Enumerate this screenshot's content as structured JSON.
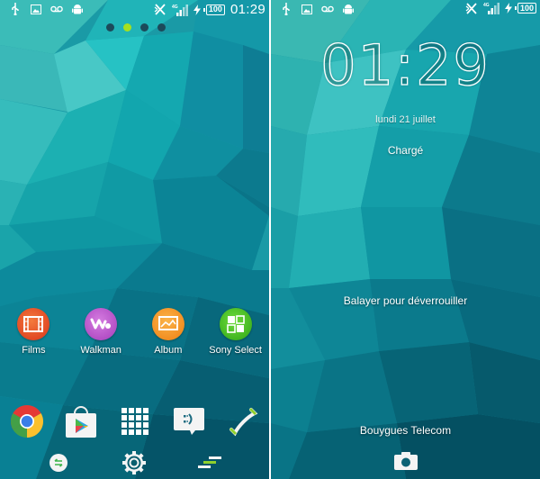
{
  "colors": {
    "wallpaper_light": "#3cc4c4",
    "wallpaper_dark": "#0b5f72",
    "page_dot": "#1c4a5a",
    "page_dot_active": "#a6e01e",
    "text": "#ffffff"
  },
  "home": {
    "status_bar": {
      "left_icons": [
        "usb-icon",
        "image-icon",
        "voicemail-icon",
        "android-icon"
      ],
      "right_icons": [
        "nfc-disabled-icon",
        "signal-4g-icon",
        "charging-icon"
      ],
      "network_label": "4G",
      "battery": "100",
      "time": "01:29"
    },
    "page_indicator": {
      "count": 4,
      "active_index": 1
    },
    "apps": [
      {
        "label": "Films",
        "icon": "films-icon",
        "color": "#e8461c"
      },
      {
        "label": "Walkman",
        "icon": "walkman-icon",
        "color": "#b047c4"
      },
      {
        "label": "Album",
        "icon": "album-icon",
        "color": "#f08a14"
      },
      {
        "label": "Sony Select",
        "icon": "sony-select-icon",
        "color": "#3cb41c"
      }
    ],
    "dock": [
      {
        "name": "chrome",
        "icon": "chrome-icon"
      },
      {
        "name": "play-store",
        "icon": "play-store-icon"
      },
      {
        "name": "app-drawer",
        "icon": "app-drawer-icon"
      },
      {
        "name": "messaging",
        "icon": "messaging-icon"
      },
      {
        "name": "phone",
        "icon": "phone-icon"
      }
    ],
    "nav": [
      {
        "name": "back",
        "icon": "back-icon"
      },
      {
        "name": "settings",
        "icon": "settings-icon"
      },
      {
        "name": "recent",
        "icon": "recent-icon"
      }
    ]
  },
  "lock": {
    "status_bar": {
      "left_icons": [
        "usb-icon",
        "image-icon",
        "voicemail-icon",
        "android-icon"
      ],
      "right_icons": [
        "nfc-disabled-icon",
        "signal-4g-icon",
        "charging-icon"
      ],
      "network_label": "4G",
      "battery": "100"
    },
    "clock_hours": "01",
    "clock_minutes": "29",
    "date": "lundi 21 juillet",
    "charge_status": "Chargé",
    "swipe_hint": "Balayer pour déverrouiller",
    "carrier": "Bouygues Telecom",
    "camera_icon": "camera-icon"
  }
}
